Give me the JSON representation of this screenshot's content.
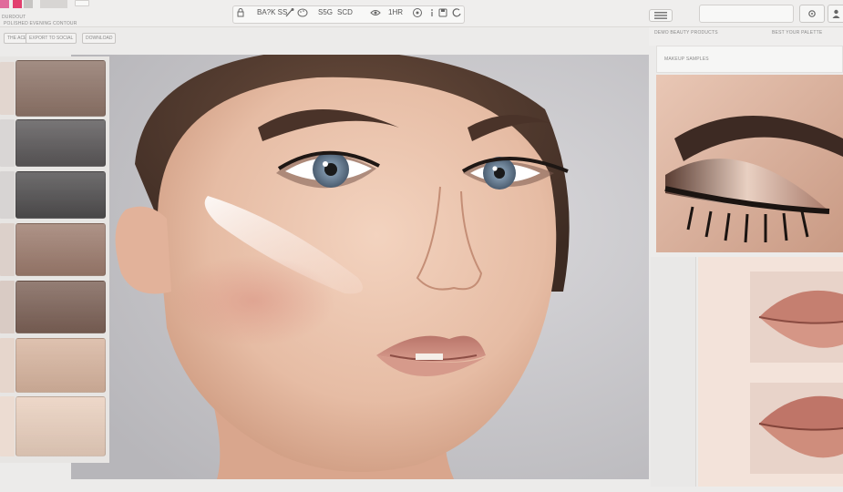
{
  "toolbar": {
    "top_left_label": "DURDOUT",
    "mode_label": "BA?K SS",
    "item_a": "S5G",
    "item_b": "SCD",
    "item_c": "1HR",
    "search_placeholder": ""
  },
  "palette_chips": [
    {
      "label": "THE ACE"
    },
    {
      "label": "EXPORT TO SOCIAL"
    },
    {
      "label": "DOWNLOAD"
    }
  ],
  "left_caption": "POLISHED EVENING CONTOUR",
  "right_panel": {
    "head_left": "DEMO BEAUTY PRODUCTS",
    "head_right": "BEST YOUR PALETTE",
    "sub_label": "MAKEUP SAMPLES"
  },
  "colors": {
    "accent_pink": "#e65a8a",
    "skin_base": "#e9bfa8",
    "lip_color": "#c98576"
  },
  "palette": {
    "shades": [
      {
        "name": "taupe",
        "color": "#8e7468"
      },
      {
        "name": "charcoal",
        "color": "#5a5758"
      },
      {
        "name": "graphite",
        "color": "#4f4d4e"
      },
      {
        "name": "mocha",
        "color": "#9c7b6d"
      },
      {
        "name": "cocoa",
        "color": "#7c6156"
      },
      {
        "name": "sand",
        "color": "#d7b49e"
      },
      {
        "name": "cream",
        "color": "#e9cfbd"
      }
    ]
  }
}
